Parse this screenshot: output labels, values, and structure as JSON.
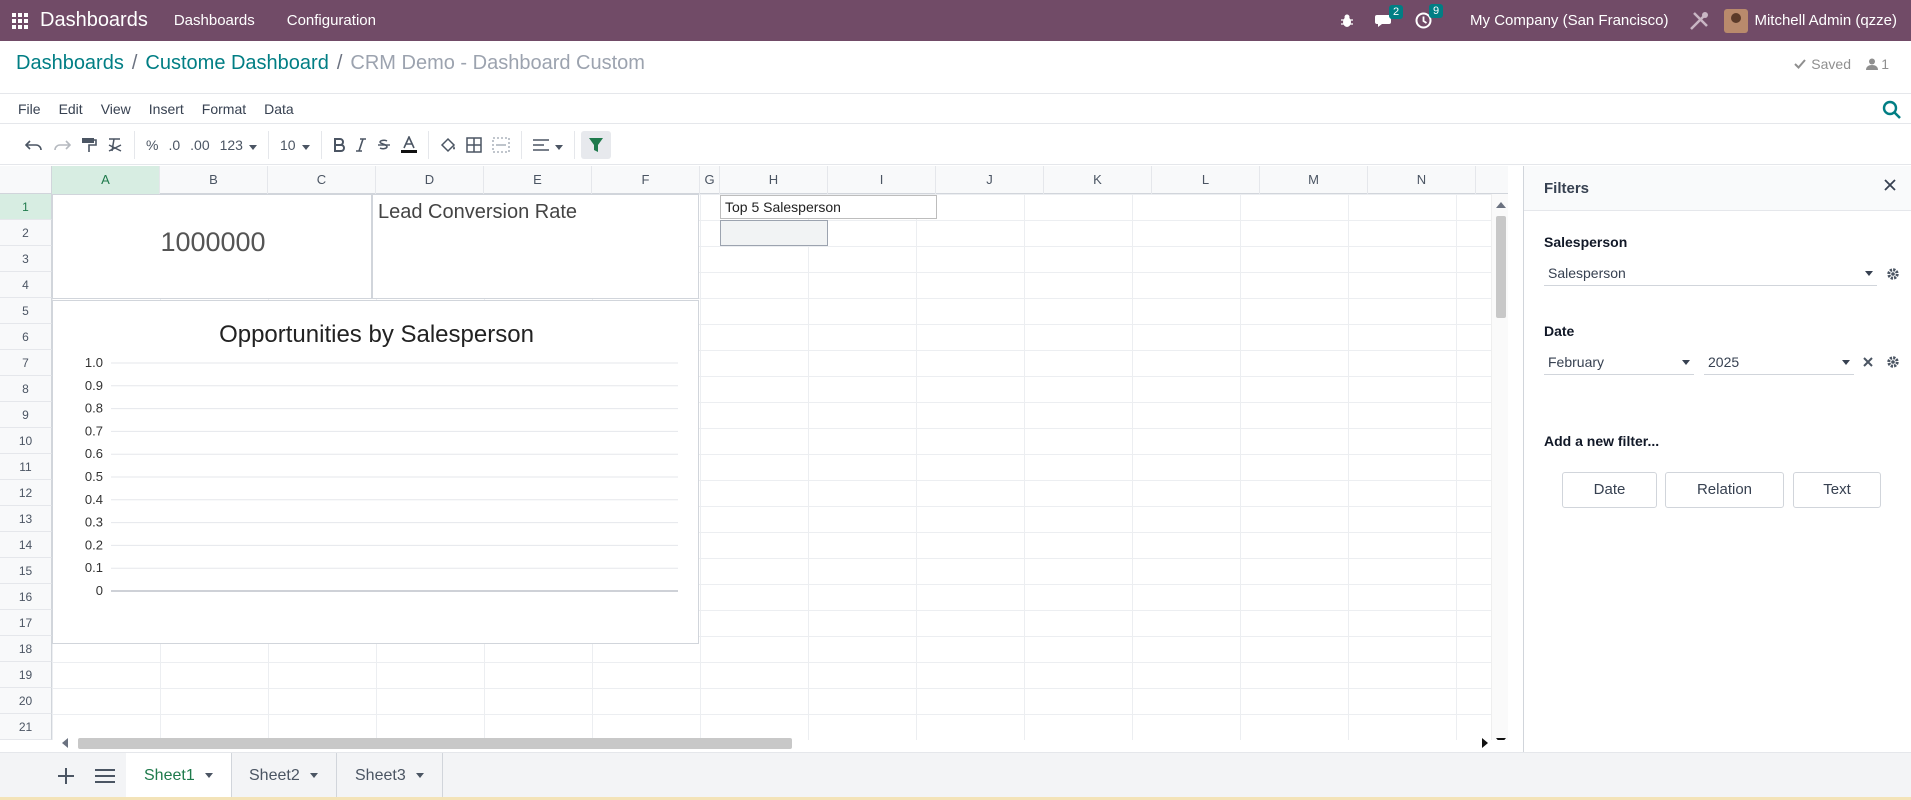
{
  "topbar": {
    "brand": "Dashboards",
    "nav": [
      "Dashboards",
      "Configuration"
    ],
    "chat_badge": "2",
    "activity_badge": "9",
    "company": "My Company (San Francisco)",
    "user": "Mitchell Admin (qzze)"
  },
  "breadcrumb": {
    "items": [
      "Dashboards",
      "Custome Dashboard"
    ],
    "current": "CRM Demo - Dashboard Custom",
    "saved": "Saved",
    "users": "1"
  },
  "menubar": [
    "File",
    "Edit",
    "View",
    "Insert",
    "Format",
    "Data"
  ],
  "toolbar": {
    "percent": "%",
    "dec1": ".0",
    "dec2": ".00",
    "num": "123",
    "font_size": "10"
  },
  "grid": {
    "columns": [
      "A",
      "B",
      "C",
      "D",
      "E",
      "F",
      "G",
      "H",
      "I",
      "J",
      "K",
      "L",
      "M",
      "N"
    ],
    "rows": [
      "1",
      "2",
      "3",
      "4",
      "5",
      "6",
      "7",
      "8",
      "9",
      "10",
      "11",
      "12",
      "13",
      "14",
      "15",
      "16",
      "17",
      "18",
      "19",
      "20",
      "21"
    ],
    "selected_column": "A",
    "selected_row": "1",
    "cell_h1": "Top 5 Salesperson"
  },
  "scorecards": {
    "value": "1000000",
    "lead_title": "Lead Conversion Rate"
  },
  "chart_data": {
    "type": "bar",
    "title": "Opportunities by Salesperson",
    "categories": [],
    "values": [],
    "xlabel": "",
    "ylabel": "",
    "ylim": [
      0,
      1.0
    ],
    "yticks": [
      "0",
      "0.1",
      "0.2",
      "0.3",
      "0.4",
      "0.5",
      "0.6",
      "0.7",
      "0.8",
      "0.9",
      "1.0"
    ],
    "grid": true
  },
  "filters": {
    "title": "Filters",
    "salesperson_label": "Salesperson",
    "salesperson_value": "Salesperson",
    "date_label": "Date",
    "date_month": "February",
    "date_year": "2025",
    "add_new": "Add a new filter...",
    "buttons": [
      "Date",
      "Relation",
      "Text"
    ]
  },
  "sheets": [
    "Sheet1",
    "Sheet2",
    "Sheet3"
  ],
  "colors": {
    "topbar": "#714b67",
    "accent": "#017e84",
    "sheet_active": "#1f7a4c"
  }
}
